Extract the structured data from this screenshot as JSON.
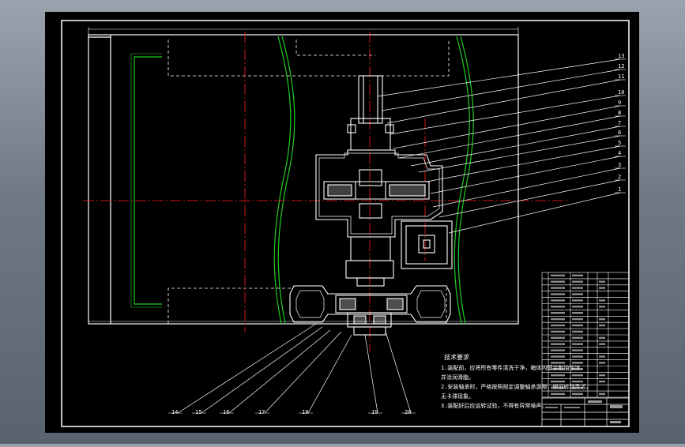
{
  "drawing": {
    "colors": {
      "background": "#000000",
      "border": "#ffffff",
      "centerline": "#ff2020",
      "outline_green": "#22cc22",
      "leader": "#ffffff"
    },
    "part_numbers": [
      "1",
      "2",
      "3",
      "4",
      "5",
      "6",
      "7",
      "8",
      "9",
      "10",
      "11",
      "12",
      "13",
      "14",
      "15",
      "16",
      "17",
      "18",
      "19",
      "20"
    ],
    "technical_requirements": {
      "heading": "技术要求",
      "lines": [
        "1.装配前，应将所有零件清洗干净，箱体内壁涂耐油油漆，",
        "   并涂润滑脂。",
        "2.安装轴承时，严格按照规定调整轴承游隙，保证转动灵活，",
        "   无卡滞现象。",
        "3.装配好后应运转试验，不得有异常噪声。"
      ]
    }
  }
}
